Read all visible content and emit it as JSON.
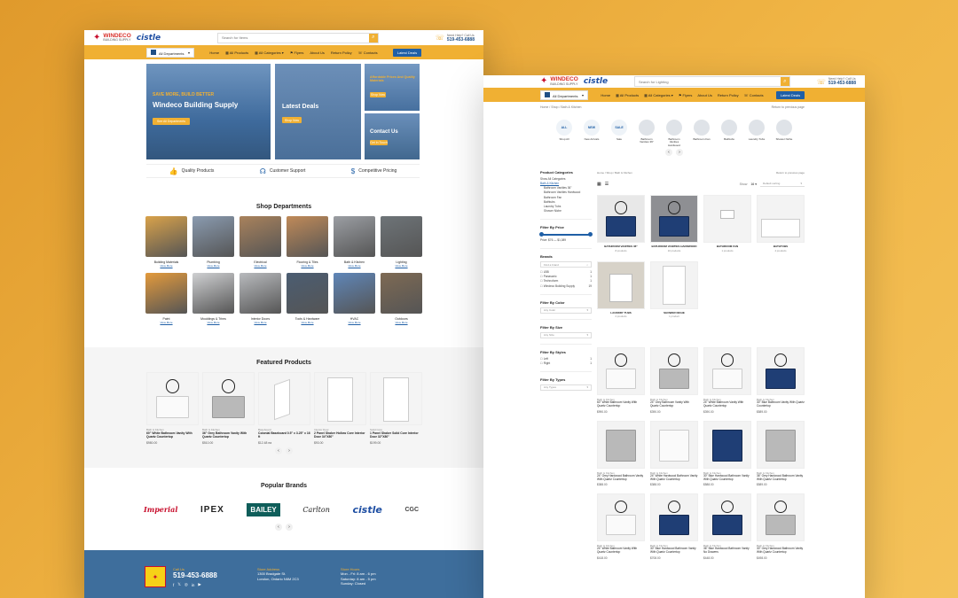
{
  "brand": {
    "logo_title": "WINDECO",
    "logo_subtitle": "BUILDING SUPPLY",
    "partner": "cistle"
  },
  "search": {
    "placeholder_home": "Search for Items",
    "placeholder_shop": "Search for Lighting"
  },
  "contact": {
    "label": "Need Help? Call Us",
    "phone": "519-453-6888"
  },
  "nav": {
    "departments": "All Departments",
    "links": [
      "Home",
      "All Products",
      "All Categories",
      "Flyers",
      "About Us",
      "Return Policy",
      "Contacts"
    ],
    "cta": "Latest Deals"
  },
  "hero": {
    "main_kicker": "SAVE MORE, BUILD BETTER",
    "main_title": "Windeco Building Supply",
    "main_button": "See All Departments",
    "deals_title": "Latest Deals",
    "deals_button": "Shop Now",
    "finance_title": "Affordable Prices And Quality Materials",
    "finance_button": "Shop Now",
    "contact_title": "Contact Us",
    "contact_button": "Get In Touch"
  },
  "features": [
    "Quality Products",
    "Customer Support",
    "Competitive Pricing"
  ],
  "departments": {
    "title": "Shop Departments",
    "view_more": "View More",
    "items": [
      {
        "name": "Building Materials",
        "color": "#d9a24a"
      },
      {
        "name": "Plumbing",
        "color": "#8a9bb0"
      },
      {
        "name": "Electrical",
        "color": "#a9825c"
      },
      {
        "name": "Flooring & Tiles",
        "color": "#c08a58"
      },
      {
        "name": "Bath & Kitchen",
        "color": "#9b9ea3"
      },
      {
        "name": "Lighting",
        "color": "#6e7478"
      },
      {
        "name": "Paint",
        "color": "#e39a3c"
      },
      {
        "name": "Mouldings & Trims",
        "color": "#cfd0d2"
      },
      {
        "name": "Interior Doors",
        "color": "#b8babd"
      },
      {
        "name": "Tools & Hardware",
        "color": "#4b5d72"
      },
      {
        "name": "HVAC",
        "color": "#5f86b8"
      },
      {
        "name": "Outdoors",
        "color": "#7e6a54"
      }
    ]
  },
  "featured": {
    "title": "Featured Products",
    "items": [
      {
        "cat": "Bath & Kitchen",
        "name": "60\" White Bathroom Vanity With Quartz Countertop",
        "price": "$980.00"
      },
      {
        "cat": "Bath & Kitchen",
        "name": "36\" Grey Bathroom Vanity With Quartz Countertop",
        "price": "$510.00"
      },
      {
        "cat": "Baseboard",
        "name": "Colonial Baseboard 0.5\" x 3.25\" x 16 ft",
        "price": "$12.48 ea"
      },
      {
        "cat": "Interior Door",
        "name": "2 Panel Shaker Hollow Core Interior Door 34\"X80\"",
        "price": "$93.00"
      },
      {
        "cat": "Solid Core",
        "name": "1 Panel Shaker Solid Core Interior Door 32\"X80\"",
        "price": "$199.00"
      }
    ]
  },
  "brands": {
    "title": "Popular Brands",
    "items": [
      "Imperial",
      "IPEX",
      "BAILEY",
      "Carlton",
      "cistle",
      "CGC"
    ]
  },
  "footer": {
    "call_label": "Call Us",
    "phone": "519-453-6888",
    "addr_label": "Store Address",
    "addr_line1": "1300 Bradgate St.",
    "addr_line2": "London, Ontario N6M 2C3",
    "hours_label": "Store Hours",
    "hours_line1": "Mon - Fri: 8 am - 6 pm",
    "hours_line2": "Saturday: 8 am - 5 pm",
    "hours_line3": "Sunday: Closed"
  },
  "shop": {
    "breadcrumb": "Home / Shop / Bath & Kitchen",
    "return_link": "Return to previous page",
    "circles": [
      {
        "badge": "ALL",
        "label": "Shop All"
      },
      {
        "badge": "NEW",
        "label": "New Arrivals"
      },
      {
        "badge": "SALE",
        "label": "Sale"
      },
      {
        "badge": "",
        "label": "Bathroom Vanities 36\""
      },
      {
        "badge": "",
        "label": "Bathroom Vanities Hardwood"
      },
      {
        "badge": "",
        "label": "Bathroom Fan"
      },
      {
        "badge": "",
        "label": "Bathtubs"
      },
      {
        "badge": "",
        "label": "Laundry Tubs"
      },
      {
        "badge": "",
        "label": "Shower Niche"
      }
    ],
    "sidebar": {
      "cat_title": "Product Categories",
      "cats": [
        "Show All Categories",
        "Bath & Kitchen",
        "Bathroom Vanities 36\"",
        "Bathroom Vanities Hardwood",
        "Bathroom Fan",
        "Bathtubs",
        "Laundry Tubs",
        "Shower Niche"
      ],
      "price_title": "Filter By Price",
      "price_range": "Price: $76 — $1,089",
      "brands_title": "Brands",
      "brands_search": "Find a brand",
      "brands": [
        {
          "name": "LBB",
          "count": "1"
        },
        {
          "name": "Panasonic",
          "count": "1"
        },
        {
          "name": "Technoform",
          "count": "1"
        },
        {
          "name": "Windeco Building Supply",
          "count": "19"
        }
      ],
      "color_title": "Filter By Color",
      "color_placeholder": "Any Color",
      "size_title": "Filter By Size",
      "size_placeholder": "Any Size",
      "styles_title": "Filter By Styles",
      "styles": [
        {
          "name": "Left",
          "count": "1"
        },
        {
          "name": "Right",
          "count": "1"
        }
      ],
      "types_title": "Filter By Types",
      "types_placeholder": "Any Types"
    },
    "toolbar": {
      "show_label": "Show",
      "show_value": "16",
      "sort_value": "Default sorting"
    },
    "subcats": [
      {
        "name": "BATHROOM VANITIES 36\"",
        "count": "8 products"
      },
      {
        "name": "BATHROOM VANITIES HARDWOOD",
        "count": "10 products"
      },
      {
        "name": "BATHROOM FAN",
        "count": "1 products"
      },
      {
        "name": "BATHTUBS",
        "count": "4 products"
      },
      {
        "name": "LAUNDRY TUBS",
        "count": "2 products"
      },
      {
        "name": "SHOWER NICHE",
        "count": "1 product"
      }
    ],
    "products": [
      {
        "cat": "Bath & Kitchen",
        "name": "60\" White Bathroom Vanity With Quartz Countertop",
        "price": "$990.00",
        "style": "w"
      },
      {
        "cat": "Bath & Kitchen",
        "name": "24\" Grey Bathroom Vanity With Quartz Countertop",
        "price": "$390.00",
        "style": "g"
      },
      {
        "cat": "Bath & Kitchen",
        "name": "24\" White Bathroom Vanity With Quartz Countertop",
        "price": "$390.00",
        "style": "w"
      },
      {
        "cat": "Bath & Kitchen",
        "name": "30\" Blue Bathroom Vanity With Quartz Countertop",
        "price": "$589.00",
        "style": "b"
      },
      {
        "cat": "Bath & Kitchen",
        "name": "24\" Grey Hardwood Bathroom Vanity With Quartz Countertop",
        "price": "$388.00",
        "style": "g"
      },
      {
        "cat": "Bath & Kitchen",
        "name": "24\" White Hardwood Bathroom Vanity With Quartz Countertop",
        "price": "$388.00",
        "style": "w"
      },
      {
        "cat": "Bath & Kitchen",
        "name": "30\" Blue Hardwood Bathroom Vanity With Quartz Countertop",
        "price": "$588.00",
        "style": "b"
      },
      {
        "cat": "Bath & Kitchen",
        "name": "36\" Grey Hardwood Bathroom Vanity With Quartz Countertop",
        "price": "$589.00",
        "style": "g"
      },
      {
        "cat": "Bath & Kitchen",
        "name": "24\" White Bathroom Vanity With Quartz Countertop",
        "price": "$418.00",
        "style": "w"
      },
      {
        "cat": "Bath & Kitchen",
        "name": "30\" Blue Hardwood Bathroom Vanity With Quartz Countertop",
        "price": "$708.00",
        "style": "b"
      },
      {
        "cat": "Bath & Kitchen",
        "name": "36\" Blue Hardwood Bathroom Vanity No Drawers",
        "price": "$448.00",
        "style": "b"
      },
      {
        "cat": "Bath & Kitchen",
        "name": "30\" Grey Hardwood Bathroom Vanity With Quartz Countertop",
        "price": "$498.00",
        "style": "g"
      }
    ]
  },
  "colors": {
    "accent": "#f0b033",
    "primary": "#1f5fa6",
    "footer": "#3e6e9c",
    "background": "#e8a838"
  }
}
